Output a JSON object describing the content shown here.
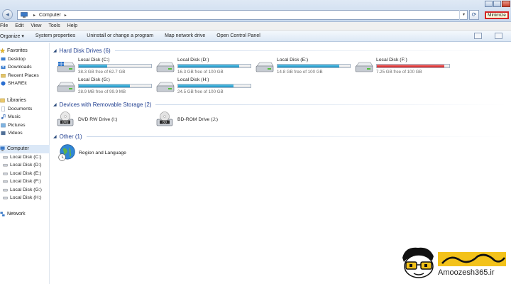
{
  "window": {
    "breadcrumb": [
      "Computer"
    ],
    "tooltip": "Minimize"
  },
  "menu": [
    "File",
    "Edit",
    "View",
    "Tools",
    "Help"
  ],
  "commands": [
    "Organize",
    "System properties",
    "Uninstall or change a program",
    "Map network drive",
    "Open Control Panel"
  ],
  "sidebar": {
    "favorites": {
      "label": "Favorites",
      "items": [
        "Desktop",
        "Downloads",
        "Recent Places",
        "SHAREit"
      ]
    },
    "libraries": {
      "label": "Libraries",
      "items": [
        "Documents",
        "Music",
        "Pictures",
        "Videos"
      ]
    },
    "computer": {
      "label": "Computer",
      "items": [
        "Local Disk (C:)",
        "Local Disk (D:)",
        "Local Disk (E:)",
        "Local Disk (F:)",
        "Local Disk (G:)",
        "Local Disk (H:)"
      ]
    },
    "network": {
      "label": "Network"
    }
  },
  "groups": {
    "hdd": "Hard Disk Drives (6)",
    "removable": "Devices with Removable Storage (2)",
    "other": "Other (1)"
  },
  "drives": [
    {
      "name": "Local Disk (C:)",
      "free": "38.3 GB free of 62.7 GB",
      "used_fraction": 0.39,
      "critical": false
    },
    {
      "name": "Local Disk (D:)",
      "free": "16.3 GB free of 100 GB",
      "used_fraction": 0.84,
      "critical": false
    },
    {
      "name": "Local Disk (E:)",
      "free": "14.8 GB free of 100 GB",
      "used_fraction": 0.85,
      "critical": false
    },
    {
      "name": "Local Disk (F:)",
      "free": "7.25 GB free of 100 GB",
      "used_fraction": 0.93,
      "critical": true
    },
    {
      "name": "Local Disk (G:)",
      "free": "28.9 MB free of 99.9 MB",
      "used_fraction": 0.71,
      "critical": false
    },
    {
      "name": "Local Disk (H:)",
      "free": "24.5 GB free of 100 GB",
      "used_fraction": 0.76,
      "critical": false
    }
  ],
  "removable": [
    {
      "name": "DVD RW Drive (I:)"
    },
    {
      "name": "BD-ROM Drive (J:)"
    }
  ],
  "other": [
    {
      "name": "Region and Language"
    }
  ],
  "logo": {
    "text": "Amoozesh365.ir"
  },
  "colors": {
    "accent": "#1e3d8f",
    "bar_normal": "#26a0d0",
    "bar_critical": "#d21c1c",
    "tooltip_border": "#d42424"
  }
}
